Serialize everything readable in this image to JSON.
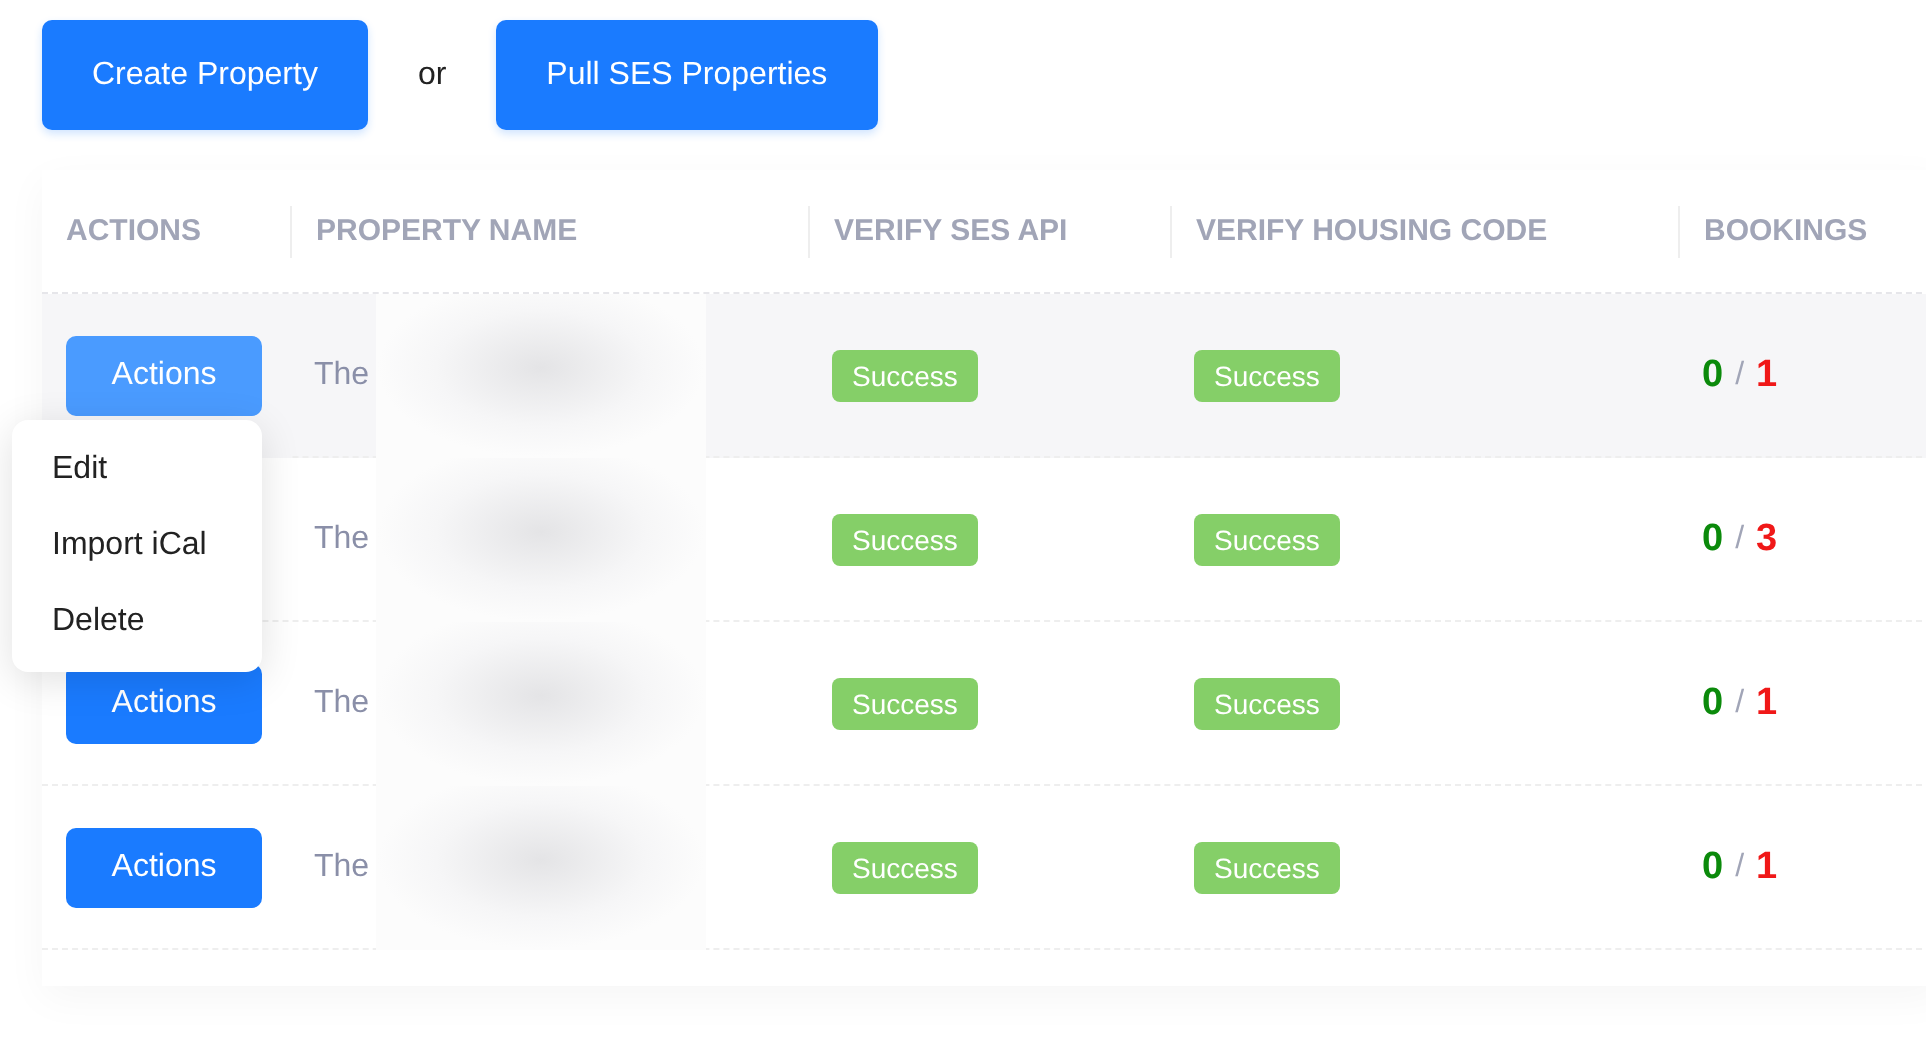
{
  "toolbar": {
    "create_button": "Create Property",
    "separator": "or",
    "pull_button": "Pull SES Properties"
  },
  "table": {
    "columns": [
      "ACTIONS",
      "PROPERTY NAME",
      "VERIFY SES API",
      "VERIFY HOUSING CODE",
      "BOOKINGS"
    ],
    "rows": [
      {
        "active": true,
        "action_label": "Actions",
        "name": "The",
        "ses_status": "Success",
        "housing_status": "Success",
        "bookings_done": "0",
        "bookings_sep": "/",
        "bookings_total": "1"
      },
      {
        "name": "The",
        "ses_status": "Success",
        "housing_status": "Success",
        "bookings_done": "0",
        "bookings_sep": "/",
        "bookings_total": "3"
      },
      {
        "active": false,
        "action_label": "Actions",
        "name": "The",
        "ses_status": "Success",
        "housing_status": "Success",
        "bookings_done": "0",
        "bookings_sep": "/",
        "bookings_total": "1"
      },
      {
        "active": false,
        "action_label": "Actions",
        "name": "The",
        "ses_status": "Success",
        "housing_status": "Success",
        "bookings_done": "0",
        "bookings_sep": "/",
        "bookings_total": "1"
      }
    ]
  },
  "actions_menu": {
    "items": [
      "Edit",
      "Import iCal",
      "Delete"
    ]
  }
}
